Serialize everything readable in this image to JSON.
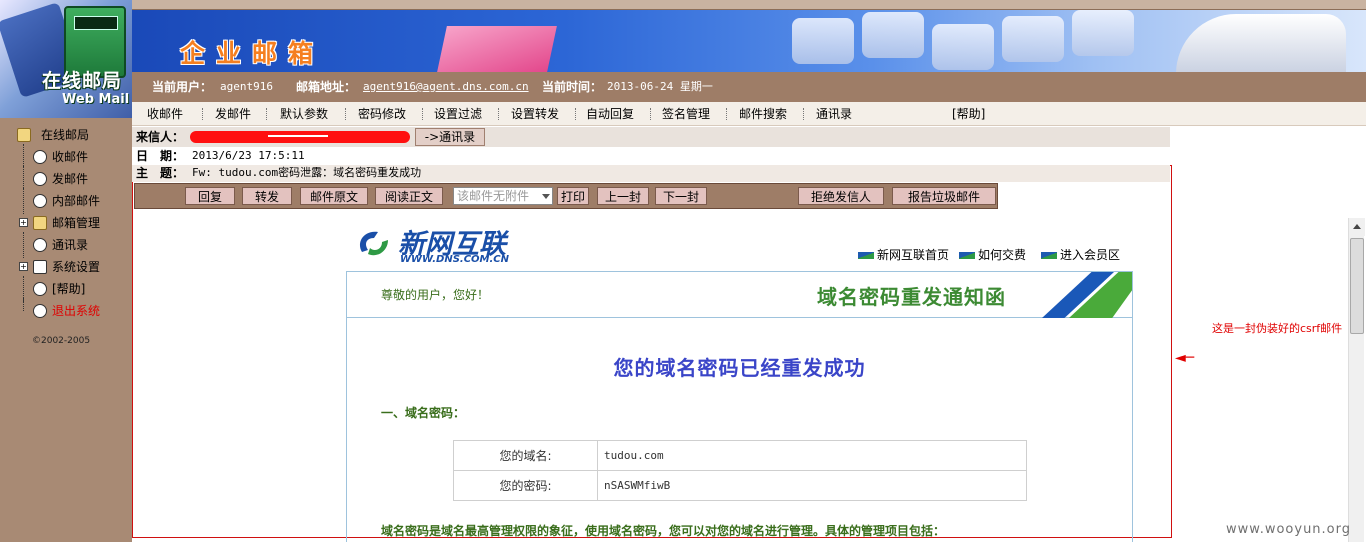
{
  "sidebar": {
    "logo_title": "在线邮局",
    "logo_sub": "Web Mail",
    "items": [
      {
        "label": "在线邮局"
      },
      {
        "label": "收邮件"
      },
      {
        "label": "发邮件"
      },
      {
        "label": "内部邮件"
      },
      {
        "label": "邮箱管理"
      },
      {
        "label": "通讯录"
      },
      {
        "label": "系统设置"
      },
      {
        "label": "[帮助]"
      },
      {
        "label": "退出系统"
      }
    ],
    "copyright": "©2002-2005"
  },
  "banner": {
    "title": "企业邮箱"
  },
  "userbar": {
    "user_label": "当前用户：",
    "user_value": "agent916",
    "email_label": "邮箱地址：",
    "email_value": "agent916@agent.dns.com.cn",
    "time_label": "当前时间：",
    "time_value": "2013-06-24 星期一"
  },
  "menu": [
    "收邮件",
    "发邮件",
    "默认参数",
    "密码修改",
    "设置过滤",
    "设置转发",
    "自动回复",
    "签名管理",
    "邮件搜索",
    "通讯录",
    "[帮助]"
  ],
  "header": {
    "from_label": "来信人：",
    "to_contacts": "->通讯录",
    "date_label": "日　期：",
    "date_value": "2013/6/23 17:5:11",
    "subject_label": "主　题：",
    "subject_value": "Fw: tudou.com密码泄露：域名密码重发成功"
  },
  "toolbar": {
    "buttons": [
      "回复",
      "转发",
      "邮件原文",
      "阅读正文",
      "打印",
      "上一封",
      "下一封",
      "拒绝发信人",
      "报告垃圾邮件"
    ],
    "attachment_select": "该邮件无附件"
  },
  "email": {
    "logo_text": "新网互联",
    "logo_url": "WWW.DNS.COM.CN",
    "links": [
      "新网互联首页",
      "如何交费",
      "进入会员区"
    ],
    "greeting": "尊敬的用户，您好！",
    "notice_title": "域名密码重发通知函",
    "heading": "您的域名密码已经重发成功",
    "section1": "一、域名密码：",
    "table": [
      {
        "key": "您的域名:",
        "value": "tudou.com"
      },
      {
        "key": "您的密码:",
        "value": "nSASWMfiwB"
      }
    ],
    "description": "域名密码是域名最高管理权限的象征，使用域名密码，您可以对您的域名进行管理。具体的管理项目包括："
  },
  "annotation": "这是一封伪装好的csrf邮件",
  "watermark": "www.wooyun.org",
  "colors": {
    "sidebar": "#a88a74",
    "userbar": "#9e7d67",
    "accent_red": "#e00000",
    "heading_blue": "#3a45c8",
    "green_text": "#3a6e1c"
  }
}
